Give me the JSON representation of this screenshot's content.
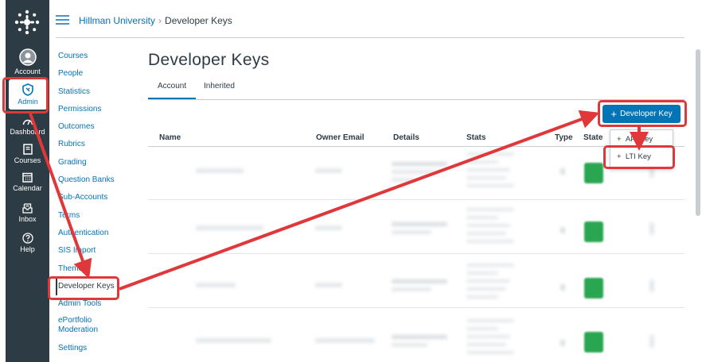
{
  "global_nav": {
    "items": [
      {
        "label": "Account",
        "icon": "avatar-icon"
      },
      {
        "label": "Admin",
        "icon": "shield-icon"
      },
      {
        "label": "Dashboard",
        "icon": "dashboard-icon"
      },
      {
        "label": "Courses",
        "icon": "book-icon"
      },
      {
        "label": "Calendar",
        "icon": "calendar-icon"
      },
      {
        "label": "Inbox",
        "icon": "inbox-icon"
      },
      {
        "label": "Help",
        "icon": "help-icon"
      }
    ]
  },
  "header": {
    "breadcrumb_root": "Hillman University",
    "breadcrumb_current": "Developer Keys"
  },
  "course_nav": {
    "items": [
      "Courses",
      "People",
      "Statistics",
      "Permissions",
      "Outcomes",
      "Rubrics",
      "Grading",
      "Question Banks",
      "Sub-Accounts",
      "Terms",
      "Authentication",
      "SIS Import",
      "Themes",
      "Developer Keys",
      "Admin Tools",
      "ePortfolio Moderation",
      "Settings"
    ]
  },
  "main": {
    "title": "Developer Keys",
    "tabs": [
      "Account",
      "Inherited"
    ],
    "add_button": "Developer Key",
    "columns": [
      "Name",
      "Owner Email",
      "Details",
      "Stats",
      "Type",
      "State"
    ],
    "dropdown": [
      "API Key",
      "LTI Key"
    ]
  },
  "colors": {
    "accent": "#0374b5",
    "nav_bg": "#2d3b45",
    "annotation": "#e0373b",
    "toggle_on": "#2aa552"
  }
}
